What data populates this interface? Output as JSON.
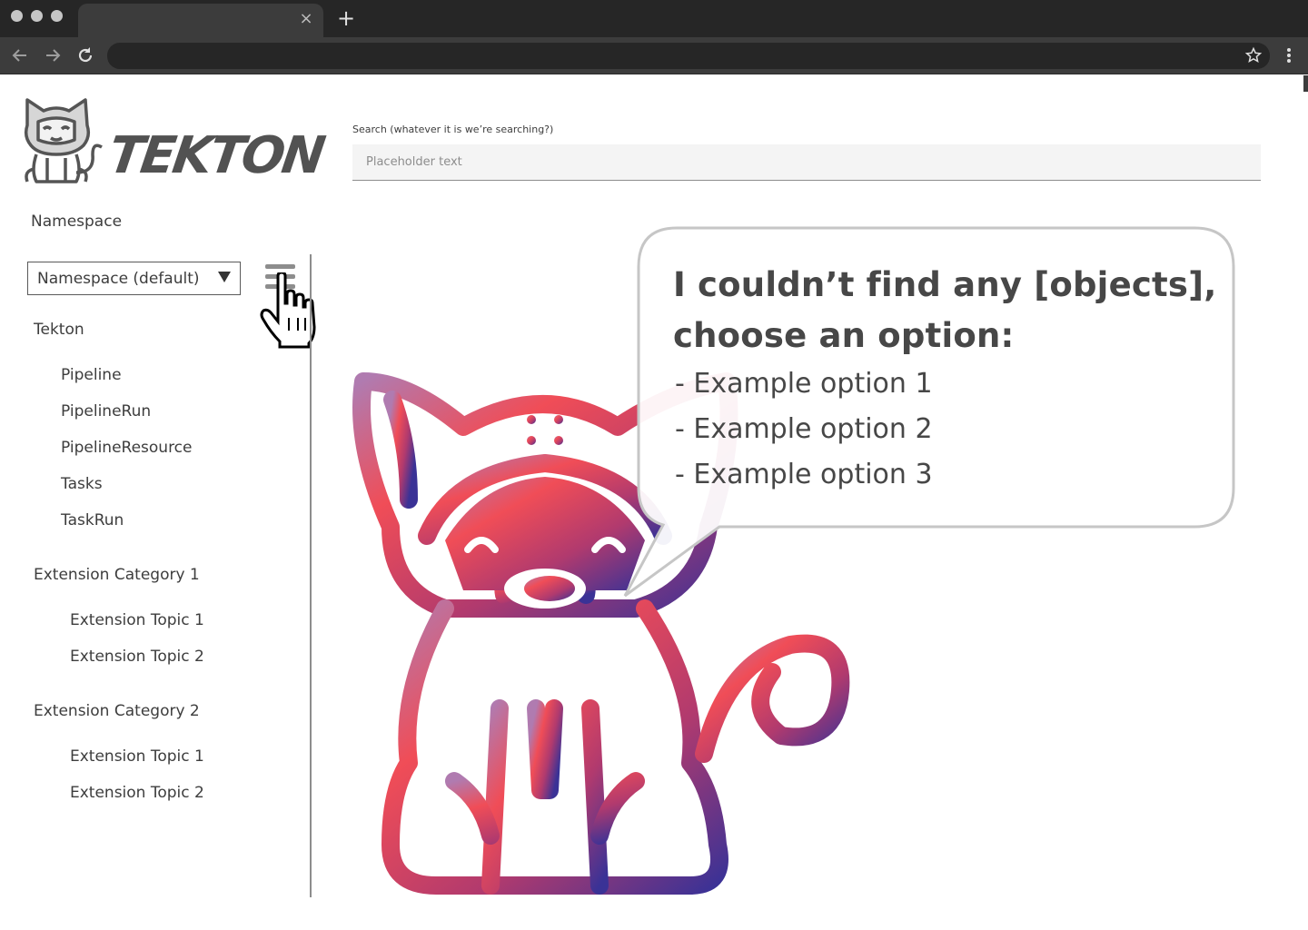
{
  "browser": {
    "tab_close_glyph": "×",
    "new_tab_glyph": "+"
  },
  "sidebar": {
    "logo_text": "TEKTON",
    "namespace_label": "Namespace",
    "namespace_select": "Namespace (default)",
    "categories": [
      {
        "label": "Tekton",
        "items": [
          "Pipeline",
          "PipelineRun",
          "PipelineResource",
          "Tasks",
          "TaskRun"
        ]
      },
      {
        "label": "Extension Category 1",
        "items": [
          "Extension Topic 1",
          "Extension Topic 2"
        ]
      },
      {
        "label": "Extension Category 2",
        "items": [
          "Extension Topic 1",
          "Extension Topic 2"
        ]
      }
    ]
  },
  "search": {
    "label": "Search (whatever it is we’re searching?)",
    "placeholder": "Placeholder text"
  },
  "empty_state": {
    "title_line1": "I couldn’t find any [objects],",
    "title_line2": "choose an option:",
    "options": [
      "- Example option 1",
      "- Example option 2",
      "- Example option 3"
    ]
  },
  "colors": {
    "gradient_start": "#f04d57",
    "gradient_end": "#3a3296",
    "chrome_dark": "#262626",
    "chrome_mid": "#3c3c3c"
  },
  "icons": [
    "close-icon",
    "plus-icon",
    "back-arrow-icon",
    "forward-arrow-icon",
    "reload-icon",
    "star-icon",
    "more-vertical-icon",
    "hamburger-icon",
    "pointer-hand-icon",
    "tekton-cat-icon"
  ]
}
